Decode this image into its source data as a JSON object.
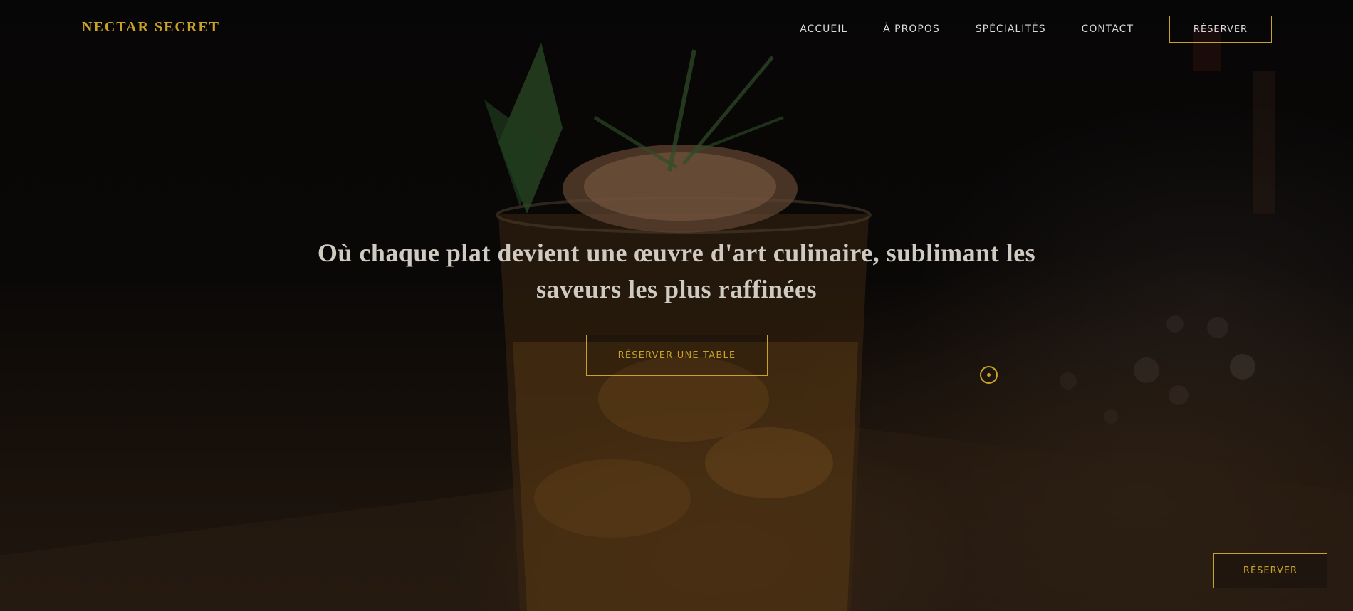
{
  "header": {
    "logo": "NECTAR SECRET",
    "nav": [
      {
        "label": "ACCUEIL"
      },
      {
        "label": "À PROPOS"
      },
      {
        "label": "SPÉCIALITÉS"
      },
      {
        "label": "CONTACT"
      }
    ],
    "cta_label": "RÉSERVER"
  },
  "hero": {
    "tagline": "Où chaque plat devient une œuvre d'art culinaire, sublimant les saveurs les plus raffinées",
    "button_label": "RÉSERVER UNE TABLE",
    "background_icon": "cocktail-glass-photo"
  },
  "floating_cta": {
    "label": "RÉSERVER"
  },
  "colors": {
    "accent": "#c9a227",
    "text_light": "#d9d9d9",
    "background": "#050404"
  }
}
